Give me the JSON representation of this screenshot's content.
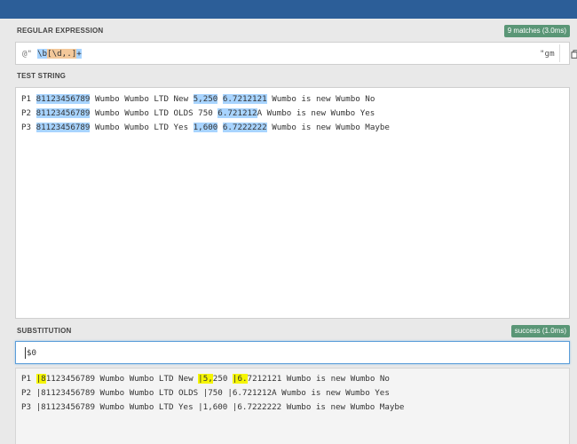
{
  "regex": {
    "label": "REGULAR EXPRESSION",
    "badge": "9 matches (3.0ms)",
    "prefix": "@\"",
    "pattern_parts": [
      "\\b",
      "[\\d,.]",
      "+"
    ],
    "suffix": "\"gm"
  },
  "test_string": {
    "label": "TEST STRING",
    "lines": [
      [
        "P1 ",
        "81123456789",
        " Wumbo Wumbo LTD New ",
        "5,250",
        " ",
        "6.7212121",
        " Wumbo is new Wumbo No"
      ],
      [
        "P2 ",
        "81123456789",
        " Wumbo Wumbo LTD OLDS 750 ",
        "6.721212",
        "A Wumbo is new Wumbo Yes"
      ],
      [
        "P3 ",
        "81123456789",
        " Wumbo Wumbo LTD Yes ",
        "1,600",
        " ",
        "6.7222222",
        " Wumbo is new Wumbo Maybe"
      ]
    ]
  },
  "substitution": {
    "label": "SUBSTITUTION",
    "badge": "success (1.0ms)",
    "value": "$0",
    "result": {
      "line1": [
        "P1 ",
        "|8",
        "1123456789 Wumbo Wumbo LTD New ",
        "|5,",
        "250 ",
        "|6.",
        "7212121 Wumbo is new Wumbo No"
      ],
      "line2": "P2 |81123456789 Wumbo Wumbo LTD OLDS |750 |6.721212A Wumbo is new Wumbo Yes",
      "line3": "P3 |81123456789 Wumbo Wumbo LTD Yes |1,600 |6.7222222 Wumbo is new Wumbo Maybe"
    }
  }
}
